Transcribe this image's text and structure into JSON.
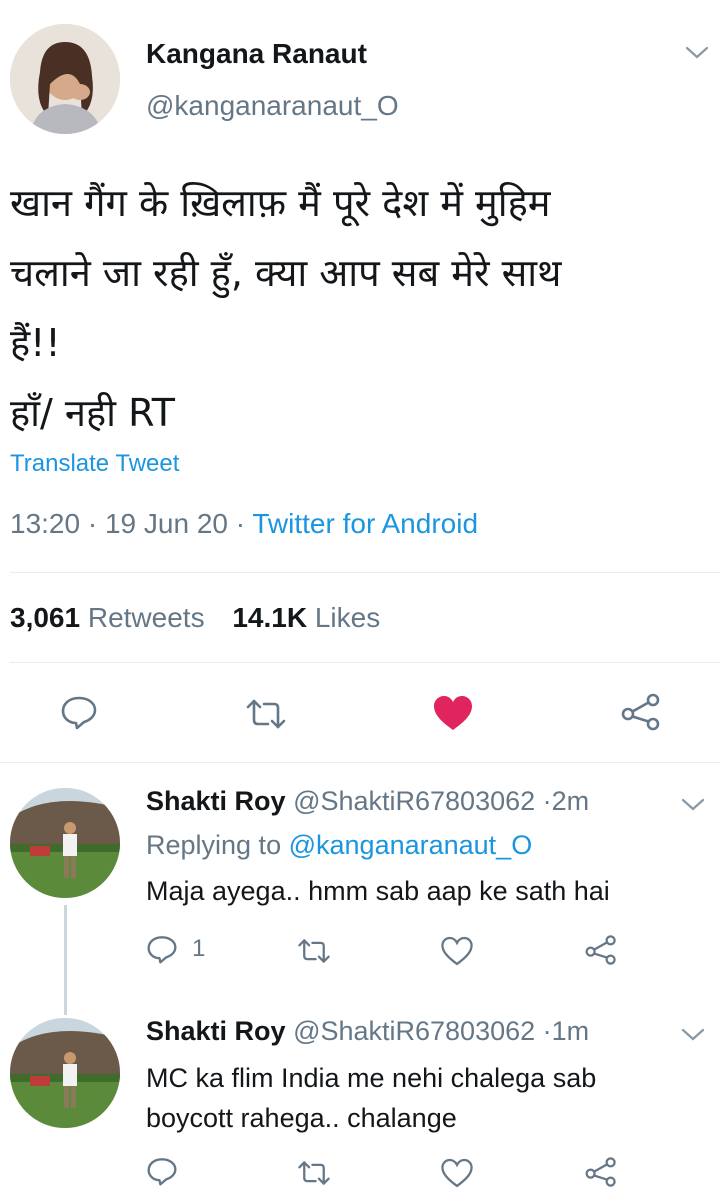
{
  "tweet": {
    "author_name": "Kangana Ranaut",
    "author_handle": "@kanganaranaut_O",
    "text_line1": "खान गैंग के ख़िलाफ़ मैं पूरे देश में मुहिम",
    "text_line2": "चलाने जा रही हुँ, क्या आप सब मेरे साथ",
    "text_line3": "हैं!!",
    "text_line4": "हाँ/ नही RT",
    "translate_label": "Translate Tweet",
    "time": "13:20",
    "date": "19 Jun 20",
    "source": "Twitter for Android",
    "retweets_count": "3,061",
    "retweets_label": "Retweets",
    "likes_count": "14.1K",
    "likes_label": "Likes"
  },
  "replies": [
    {
      "name": "Shakti Roy",
      "handle": "@ShaktiR67803062",
      "age": "2m",
      "replying_prefix": "Replying to",
      "replying_to": "@kanganaranaut_O",
      "text": "Maja ayega.. hmm sab aap ke sath hai",
      "reply_count": "1"
    },
    {
      "name": "Shakti Roy",
      "handle": "@ShaktiR67803062",
      "age": "1m",
      "text_line1": "MC ka flim India me nehi chalega sab",
      "text_line2": "boycott rahega.. chalange"
    }
  ],
  "separator": "·",
  "colors": {
    "accent": "#1b95e0",
    "like": "#e0245e",
    "muted": "#657786",
    "divider": "#e6ecf0"
  },
  "icons": [
    "chevron-down-icon",
    "reply-icon",
    "retweet-icon",
    "like-icon",
    "share-icon"
  ]
}
